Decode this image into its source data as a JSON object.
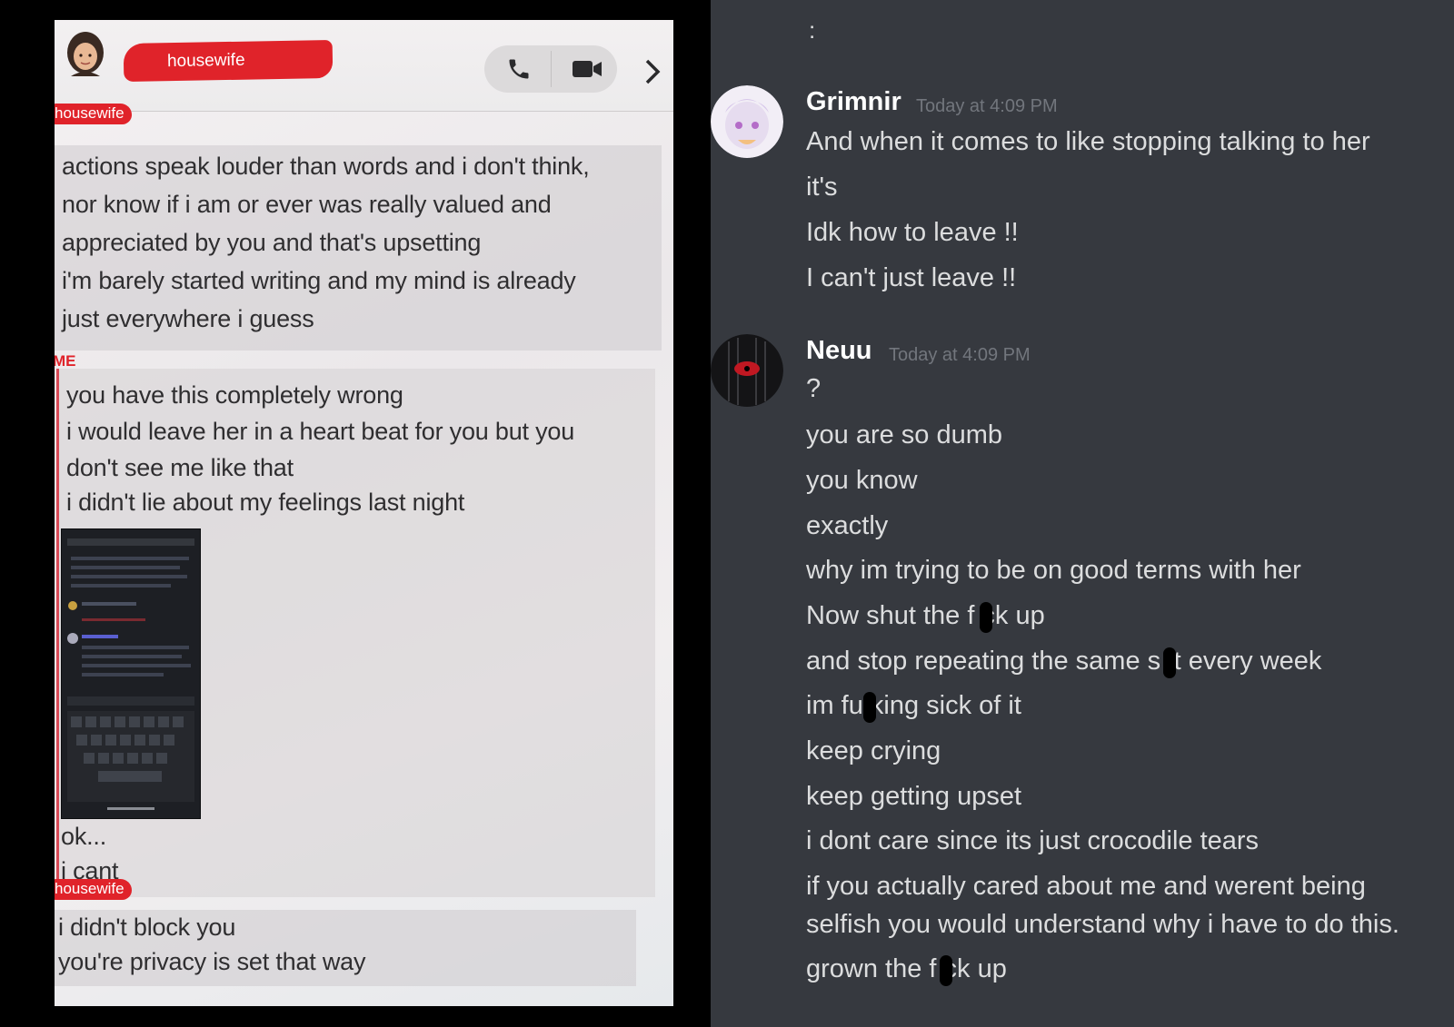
{
  "phone": {
    "contact_name": "housewife",
    "avatar_icon": "memoji-avatar",
    "sender_label": "housewife",
    "me_label": "ME",
    "message_group_1": [
      "actions speak louder than words and i don't think,",
      "nor know if i am or ever was really valued and",
      "appreciated by you and that's upsetting",
      "i'm barely started writing and my mind is already",
      "just everywhere i guess"
    ],
    "message_group_me": [
      "you have this completely wrong",
      "i would leave her in a heart beat for you but you",
      "don't see me like that",
      "i didn't lie about my feelings last night"
    ],
    "message_group_me_after": [
      "ok...",
      "i cant"
    ],
    "message_group_2": [
      "i didn't block you",
      "you're privacy is set that way"
    ]
  },
  "discord": {
    "top_colon": ":",
    "colors": {
      "background": "#36393f",
      "name": "#ffffff",
      "text": "#dcddde",
      "timestamp": "#72767d"
    },
    "messages": [
      {
        "author": "Grimnir",
        "timestamp": "Today at 4:09 PM",
        "lines": [
          "And when it comes to like stopping talking to her",
          "it's",
          "Idk how to leave !!",
          "I can't just leave !!"
        ]
      },
      {
        "author": "Neuu",
        "timestamp": "Today at 4:09 PM",
        "lines": [
          "?",
          "you are so dumb",
          "you know",
          "exactly",
          "why im trying to be on good terms with her",
          "Now shut the f ck up",
          "and stop repeating the same s it every week",
          "im fu king sick of it",
          "keep crying",
          "keep getting upset",
          "i dont care since its just crocodile tears",
          "if you actually cared about me and werent being",
          "selfish you would understand why i have to do this.",
          "grown the f ck up"
        ]
      }
    ]
  }
}
